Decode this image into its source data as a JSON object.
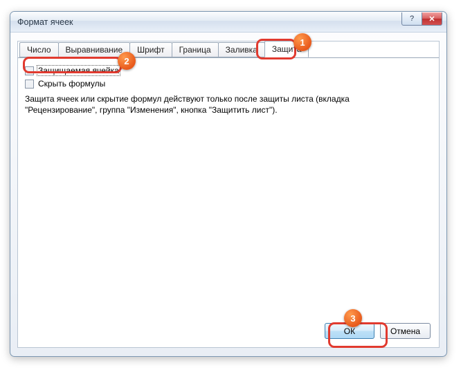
{
  "window": {
    "title": "Формат ячеек",
    "help_glyph": "?",
    "close_glyph": "✕"
  },
  "tabs": [
    {
      "label": "Число"
    },
    {
      "label": "Выравнивание"
    },
    {
      "label": "Шрифт"
    },
    {
      "label": "Граница"
    },
    {
      "label": "Заливка"
    },
    {
      "label": "Защита"
    }
  ],
  "protection": {
    "checkbox_locked": "Защищаемая ячейка",
    "checkbox_hidden": "Скрыть формулы",
    "info": "Защита ячеек или скрытие формул действуют только после защиты листа (вкладка \"Рецензирование\", группа \"Изменения\", кнопка \"Защитить лист\")."
  },
  "buttons": {
    "ok": "ОК",
    "cancel": "Отмена"
  },
  "annotations": {
    "badge1": "1",
    "badge2": "2",
    "badge3": "3"
  }
}
